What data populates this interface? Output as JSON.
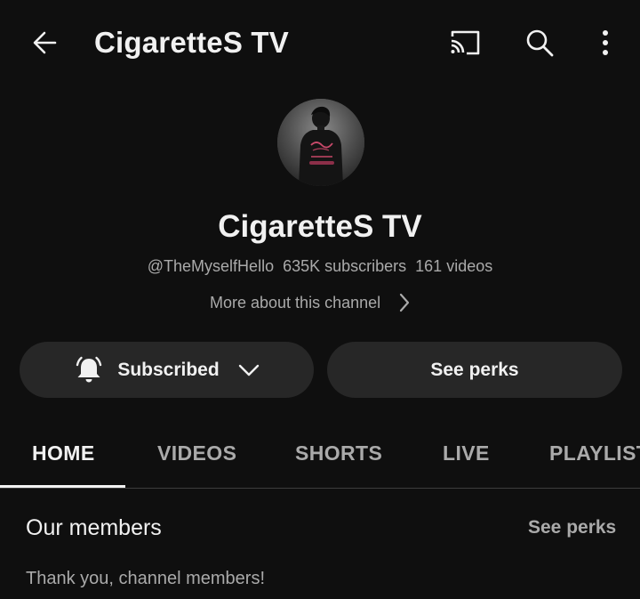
{
  "topbar": {
    "back_icon": "arrow-left-icon",
    "title": "CigaretteS TV",
    "cast_icon": "cast-icon",
    "search_icon": "search-icon",
    "more_icon": "more-vertical-icon"
  },
  "channel": {
    "avatar_icon": "channel-avatar",
    "name": "CigaretteS TV",
    "handle": "@TheMyselfHello",
    "subscribers": "635K subscribers",
    "videos": "161 videos",
    "more_about": "More about this channel"
  },
  "actions": {
    "subscribed_label": "Subscribed",
    "bell_icon": "bell-icon",
    "dropdown_icon": "chevron-down-icon",
    "perks_label": "See perks"
  },
  "tabs": [
    {
      "label": "HOME",
      "active": true
    },
    {
      "label": "VIDEOS",
      "active": false
    },
    {
      "label": "SHORTS",
      "active": false
    },
    {
      "label": "LIVE",
      "active": false
    },
    {
      "label": "PLAYLISTS",
      "active": false
    }
  ],
  "members": {
    "title": "Our members",
    "action": "See perks",
    "subtitle": "Thank you, channel members!"
  },
  "colors": {
    "background": "#0f0f0f",
    "surface": "#272727",
    "text_primary": "#f1f1f1",
    "text_secondary": "#aaaaaa"
  }
}
